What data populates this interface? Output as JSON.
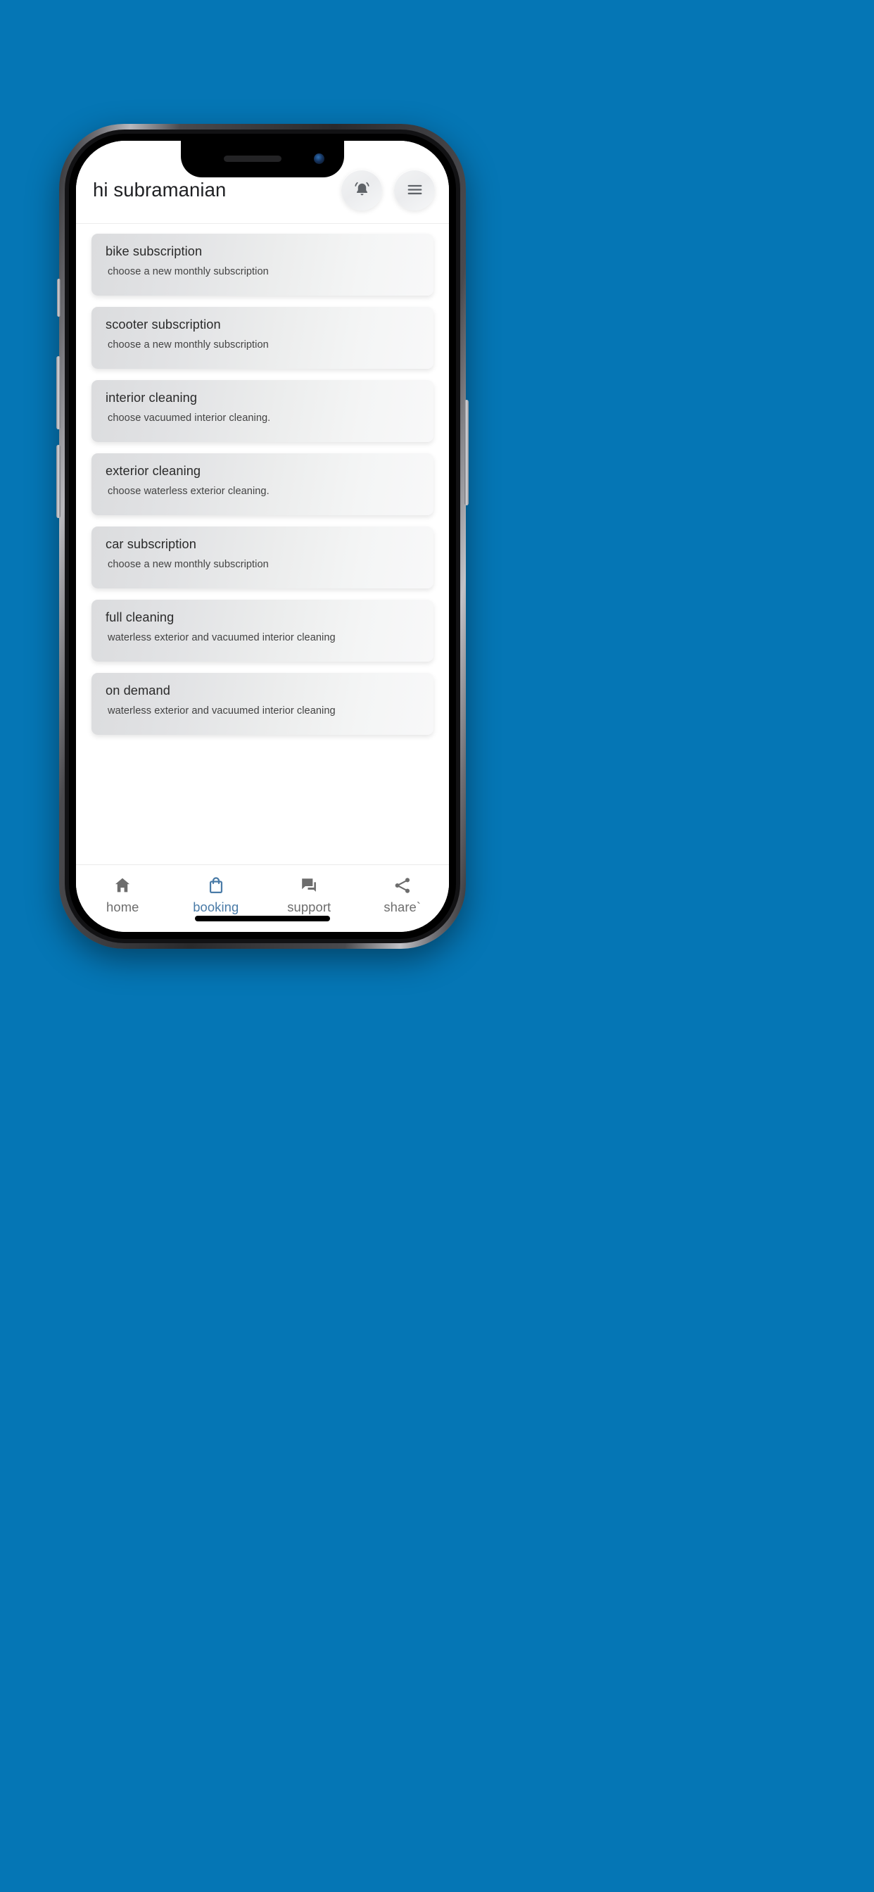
{
  "page": {
    "background_color": "#0576b5",
    "device": "phone-mockup"
  },
  "header": {
    "greeting": "hi subramanian",
    "notification_icon": "bell-icon",
    "menu_icon": "hamburger-menu-icon"
  },
  "cards": [
    {
      "title": "bike subscription",
      "subtitle": "choose a new monthly subscription"
    },
    {
      "title": "scooter subscription",
      "subtitle": "choose a new monthly subscription"
    },
    {
      "title": "interior cleaning",
      "subtitle": "choose vacuumed interior cleaning."
    },
    {
      "title": "exterior cleaning",
      "subtitle": "choose waterless exterior cleaning."
    },
    {
      "title": "car subscription",
      "subtitle": "choose a new monthly subscription"
    },
    {
      "title": "full cleaning",
      "subtitle": "waterless exterior and vacuumed interior cleaning"
    },
    {
      "title": "on demand",
      "subtitle": "waterless exterior and vacuumed interior cleaning"
    }
  ],
  "bottom_nav": {
    "active_color": "#4a7ba7",
    "inactive_color": "#6d6d6d",
    "items": [
      {
        "label": "home",
        "icon": "home-icon",
        "active": false
      },
      {
        "label": "booking",
        "icon": "shopping-bag-icon",
        "active": true
      },
      {
        "label": "support",
        "icon": "chat-bubble-icon",
        "active": false
      },
      {
        "label": "share`",
        "icon": "share-nodes-icon",
        "active": false
      }
    ]
  }
}
